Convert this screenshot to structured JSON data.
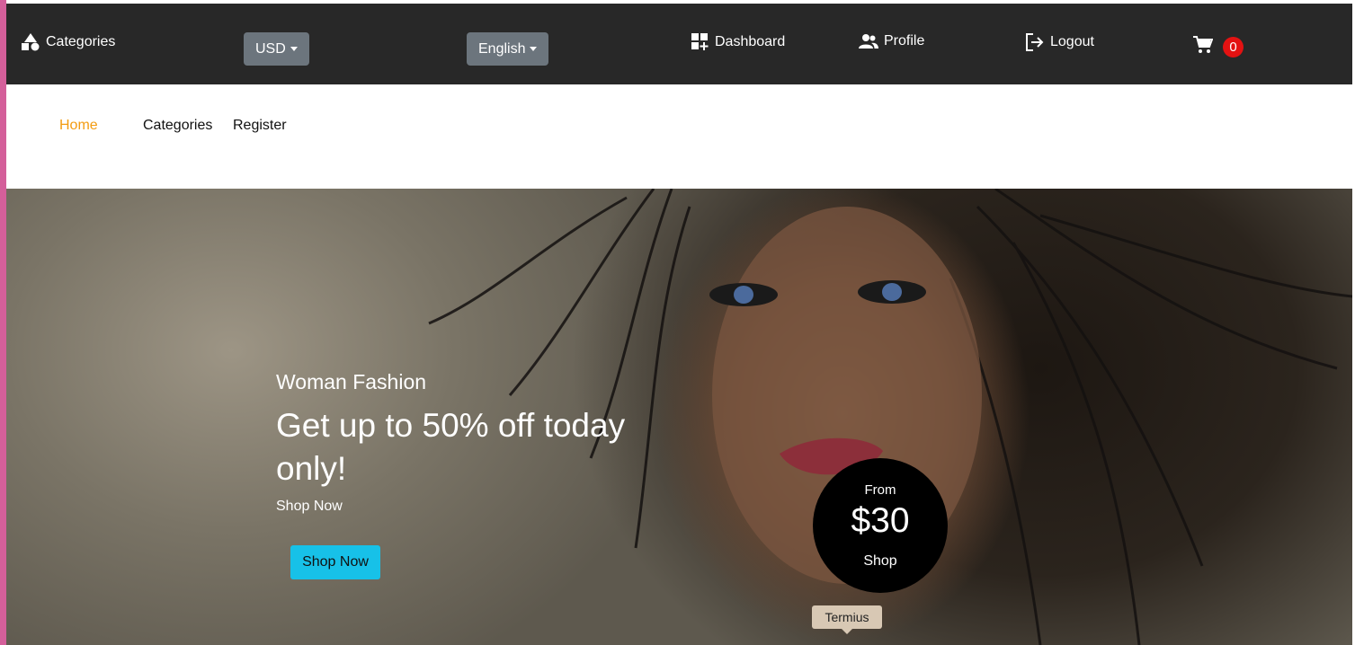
{
  "topbar": {
    "categories_label": "Categories",
    "currency": "USD",
    "language": "English",
    "dashboard_label": "Dashboard",
    "profile_label": "Profile",
    "logout_label": "Logout",
    "cart_count": "0"
  },
  "subnav": {
    "items": [
      {
        "label": "Home",
        "active": true
      },
      {
        "label": "Categories",
        "active": false
      },
      {
        "label": "Register",
        "active": false
      }
    ]
  },
  "hero": {
    "subtitle": "Woman Fashion",
    "title": "Get up to 50% off today only!",
    "link_text": "Shop Now",
    "button_label": "Shop Now",
    "price_from": "From",
    "price": "$30",
    "price_shop": "Shop"
  },
  "tooltip": "Termius",
  "colors": {
    "topbar_bg": "#282828",
    "dropdown_bg": "#6c757d",
    "active_nav": "#f39c12",
    "cart_badge": "#e31212",
    "shop_button": "#17c1e8",
    "left_strip": "#d45f9a"
  }
}
